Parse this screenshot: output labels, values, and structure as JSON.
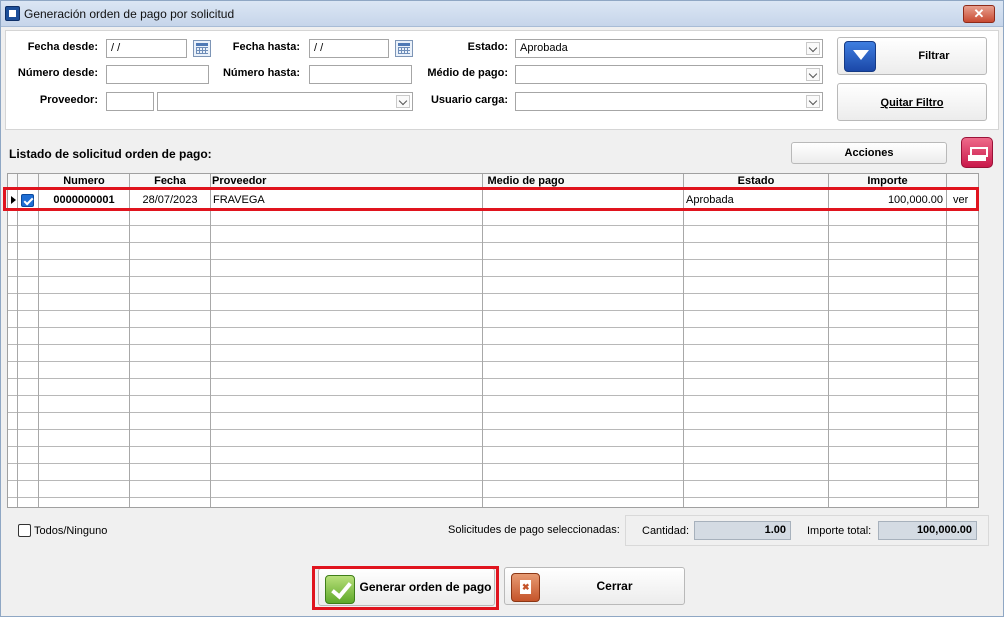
{
  "window": {
    "title": "Generación orden de pago por solicitud",
    "close_glyph": "✕"
  },
  "filters": {
    "fecha_desde": {
      "label": "Fecha desde:",
      "value": " / /"
    },
    "fecha_hasta": {
      "label": "Fecha hasta:",
      "value": " / /"
    },
    "estado": {
      "label": "Estado:",
      "value": "Aprobada"
    },
    "numero_desde": {
      "label": "Número desde:",
      "value": ""
    },
    "numero_hasta": {
      "label": "Número hasta:",
      "value": ""
    },
    "medio_pago": {
      "label": "Médio de pago:",
      "value": ""
    },
    "proveedor": {
      "label": "Proveedor:",
      "code": "",
      "value": ""
    },
    "usuario_carga": {
      "label": "Usuario carga:",
      "value": ""
    },
    "filtrar_label": "Filtrar",
    "quitar_filtro_label": "Quitar Filtro"
  },
  "list": {
    "title": "Listado de solicitud orden de pago:",
    "acciones_label": "Acciones",
    "columns": [
      "Numero",
      "Fecha",
      "Proveedor",
      "Medio de pago",
      "Estado",
      "Importe"
    ],
    "rows": [
      {
        "numero": "0000000001",
        "fecha": "28/07/2023",
        "proveedor": "FRAVEGA",
        "medio_pago": "",
        "estado": "Aprobada",
        "importe": "100,000.00",
        "link": "ver",
        "checked": true
      }
    ]
  },
  "footer": {
    "todos_label": "Todos/Ninguno",
    "seleccionadas_label": "Solicitudes de pago seleccionadas:",
    "cantidad_label": "Cantidad:",
    "cantidad_value": "1.00",
    "importe_total_label": "Importe total:",
    "importe_total_value": "100,000.00",
    "generar_label": "Generar orden de pago",
    "cerrar_label": "Cerrar"
  }
}
